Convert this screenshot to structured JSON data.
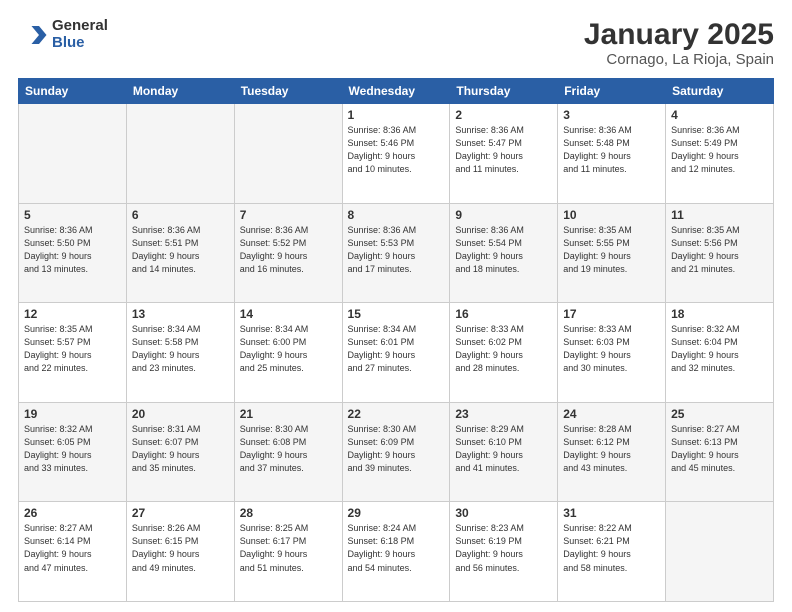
{
  "header": {
    "logo_general": "General",
    "logo_blue": "Blue",
    "title": "January 2025",
    "subtitle": "Cornago, La Rioja, Spain"
  },
  "weekdays": [
    "Sunday",
    "Monday",
    "Tuesday",
    "Wednesday",
    "Thursday",
    "Friday",
    "Saturday"
  ],
  "weeks": [
    {
      "alt": false,
      "days": [
        {
          "num": "",
          "info": ""
        },
        {
          "num": "",
          "info": ""
        },
        {
          "num": "",
          "info": ""
        },
        {
          "num": "1",
          "info": "Sunrise: 8:36 AM\nSunset: 5:46 PM\nDaylight: 9 hours\nand 10 minutes."
        },
        {
          "num": "2",
          "info": "Sunrise: 8:36 AM\nSunset: 5:47 PM\nDaylight: 9 hours\nand 11 minutes."
        },
        {
          "num": "3",
          "info": "Sunrise: 8:36 AM\nSunset: 5:48 PM\nDaylight: 9 hours\nand 11 minutes."
        },
        {
          "num": "4",
          "info": "Sunrise: 8:36 AM\nSunset: 5:49 PM\nDaylight: 9 hours\nand 12 minutes."
        }
      ]
    },
    {
      "alt": true,
      "days": [
        {
          "num": "5",
          "info": "Sunrise: 8:36 AM\nSunset: 5:50 PM\nDaylight: 9 hours\nand 13 minutes."
        },
        {
          "num": "6",
          "info": "Sunrise: 8:36 AM\nSunset: 5:51 PM\nDaylight: 9 hours\nand 14 minutes."
        },
        {
          "num": "7",
          "info": "Sunrise: 8:36 AM\nSunset: 5:52 PM\nDaylight: 9 hours\nand 16 minutes."
        },
        {
          "num": "8",
          "info": "Sunrise: 8:36 AM\nSunset: 5:53 PM\nDaylight: 9 hours\nand 17 minutes."
        },
        {
          "num": "9",
          "info": "Sunrise: 8:36 AM\nSunset: 5:54 PM\nDaylight: 9 hours\nand 18 minutes."
        },
        {
          "num": "10",
          "info": "Sunrise: 8:35 AM\nSunset: 5:55 PM\nDaylight: 9 hours\nand 19 minutes."
        },
        {
          "num": "11",
          "info": "Sunrise: 8:35 AM\nSunset: 5:56 PM\nDaylight: 9 hours\nand 21 minutes."
        }
      ]
    },
    {
      "alt": false,
      "days": [
        {
          "num": "12",
          "info": "Sunrise: 8:35 AM\nSunset: 5:57 PM\nDaylight: 9 hours\nand 22 minutes."
        },
        {
          "num": "13",
          "info": "Sunrise: 8:34 AM\nSunset: 5:58 PM\nDaylight: 9 hours\nand 23 minutes."
        },
        {
          "num": "14",
          "info": "Sunrise: 8:34 AM\nSunset: 6:00 PM\nDaylight: 9 hours\nand 25 minutes."
        },
        {
          "num": "15",
          "info": "Sunrise: 8:34 AM\nSunset: 6:01 PM\nDaylight: 9 hours\nand 27 minutes."
        },
        {
          "num": "16",
          "info": "Sunrise: 8:33 AM\nSunset: 6:02 PM\nDaylight: 9 hours\nand 28 minutes."
        },
        {
          "num": "17",
          "info": "Sunrise: 8:33 AM\nSunset: 6:03 PM\nDaylight: 9 hours\nand 30 minutes."
        },
        {
          "num": "18",
          "info": "Sunrise: 8:32 AM\nSunset: 6:04 PM\nDaylight: 9 hours\nand 32 minutes."
        }
      ]
    },
    {
      "alt": true,
      "days": [
        {
          "num": "19",
          "info": "Sunrise: 8:32 AM\nSunset: 6:05 PM\nDaylight: 9 hours\nand 33 minutes."
        },
        {
          "num": "20",
          "info": "Sunrise: 8:31 AM\nSunset: 6:07 PM\nDaylight: 9 hours\nand 35 minutes."
        },
        {
          "num": "21",
          "info": "Sunrise: 8:30 AM\nSunset: 6:08 PM\nDaylight: 9 hours\nand 37 minutes."
        },
        {
          "num": "22",
          "info": "Sunrise: 8:30 AM\nSunset: 6:09 PM\nDaylight: 9 hours\nand 39 minutes."
        },
        {
          "num": "23",
          "info": "Sunrise: 8:29 AM\nSunset: 6:10 PM\nDaylight: 9 hours\nand 41 minutes."
        },
        {
          "num": "24",
          "info": "Sunrise: 8:28 AM\nSunset: 6:12 PM\nDaylight: 9 hours\nand 43 minutes."
        },
        {
          "num": "25",
          "info": "Sunrise: 8:27 AM\nSunset: 6:13 PM\nDaylight: 9 hours\nand 45 minutes."
        }
      ]
    },
    {
      "alt": false,
      "days": [
        {
          "num": "26",
          "info": "Sunrise: 8:27 AM\nSunset: 6:14 PM\nDaylight: 9 hours\nand 47 minutes."
        },
        {
          "num": "27",
          "info": "Sunrise: 8:26 AM\nSunset: 6:15 PM\nDaylight: 9 hours\nand 49 minutes."
        },
        {
          "num": "28",
          "info": "Sunrise: 8:25 AM\nSunset: 6:17 PM\nDaylight: 9 hours\nand 51 minutes."
        },
        {
          "num": "29",
          "info": "Sunrise: 8:24 AM\nSunset: 6:18 PM\nDaylight: 9 hours\nand 54 minutes."
        },
        {
          "num": "30",
          "info": "Sunrise: 8:23 AM\nSunset: 6:19 PM\nDaylight: 9 hours\nand 56 minutes."
        },
        {
          "num": "31",
          "info": "Sunrise: 8:22 AM\nSunset: 6:21 PM\nDaylight: 9 hours\nand 58 minutes."
        },
        {
          "num": "",
          "info": ""
        }
      ]
    }
  ]
}
